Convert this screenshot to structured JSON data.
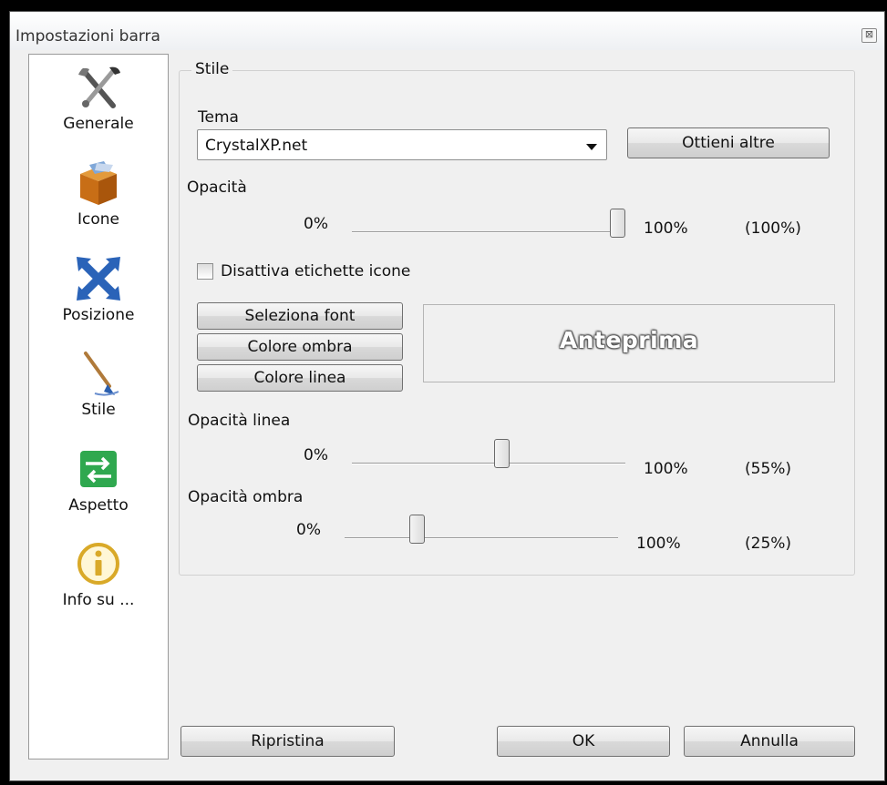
{
  "window": {
    "title": "Impostazioni barra",
    "close_label": "⊠"
  },
  "sidebar": {
    "items": [
      {
        "label": "Generale",
        "icon": "tools-icon"
      },
      {
        "label": "Icone",
        "icon": "box-icon"
      },
      {
        "label": "Posizione",
        "icon": "arrows-icon"
      },
      {
        "label": "Stile",
        "icon": "brush-icon"
      },
      {
        "label": "Aspetto",
        "icon": "switch-icon"
      },
      {
        "label": "Info su ...",
        "icon": "info-icon"
      }
    ]
  },
  "style_group": {
    "title": "Stile",
    "theme_label": "Tema",
    "theme_value": "CrystalXP.net",
    "get_more_label": "Ottieni altre",
    "opacity": {
      "label": "Opacità",
      "min_label": "0%",
      "max_label": "100%",
      "value_label": "(100%)",
      "value": 100
    },
    "disable_labels": {
      "label": "Disattiva etichette icone",
      "checked": false
    },
    "select_font_label": "Seleziona font",
    "shadow_color_label": "Colore ombra",
    "line_color_label": "Colore linea",
    "preview_text": "Anteprima",
    "line_opacity": {
      "label": "Opacità linea",
      "min_label": "0%",
      "max_label": "100%",
      "value_label": "(55%)",
      "value": 55
    },
    "shadow_opacity": {
      "label": "Opacità ombra",
      "min_label": "0%",
      "max_label": "100%",
      "value_label": "(25%)",
      "value": 25
    }
  },
  "footer": {
    "reset_label": "Ripristina",
    "ok_label": "OK",
    "cancel_label": "Annulla"
  }
}
